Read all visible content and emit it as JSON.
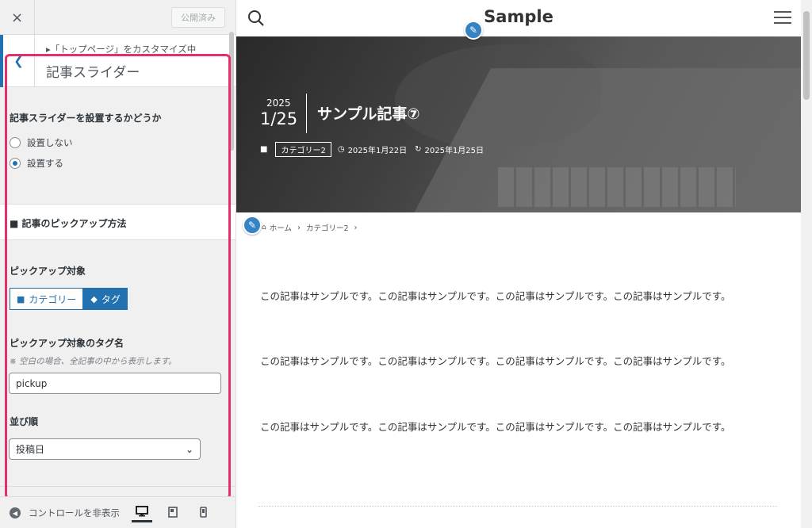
{
  "customizer": {
    "close_icon": "×",
    "publish_label": "公開済み",
    "breadcrumb": "▸「トップページ」をカスタマイズ中",
    "section_title": "記事スライダー",
    "q_show": "記事スライダーを設置するかどうか",
    "radio_no": "設置しない",
    "radio_yes": "設置する",
    "radio_selected": "設置する",
    "pickup_method": "■ 記事のピックアップ方法",
    "pickup_target": "ピックアップ対象",
    "seg_category": "カテゴリー",
    "seg_tag": "タグ",
    "seg_selected": "タグ",
    "tag_name_label": "ピックアップ対象のタグ名",
    "tag_note": "※ 空白の場合、全記事の中から表示します。",
    "tag_value": "pickup",
    "order_label": "並び順",
    "order_value": "投稿日",
    "hide_controls": "コントロールを非表示",
    "highlight_color": "#e3306d",
    "accent_color": "#2271b1"
  },
  "preview": {
    "site_title": "Sample",
    "hero": {
      "year": "2025",
      "month_day": "1/25",
      "title": "サンプル記事⑦",
      "category": "カテゴリー2",
      "published": "2025年1月22日",
      "updated": "2025年1月25日"
    },
    "breadcrumb": {
      "home": "ホーム",
      "category": "カテゴリー2"
    },
    "paragraphs": [
      "この記事はサンプルです。この記事はサンプルです。この記事はサンプルです。この記事はサンプルです。",
      "この記事はサンプルです。この記事はサンプルです。この記事はサンプルです。この記事はサンプルです。",
      "この記事はサンプルです。この記事はサンプルです。この記事はサンプルです。この記事はサンプルです。"
    ]
  },
  "icons": {
    "close": "close-icon",
    "back": "chevron-left-icon",
    "search": "search-icon",
    "menu": "hamburger-menu-icon",
    "edit": "pencil-icon",
    "folder": "folder-icon",
    "tag": "tag-icon",
    "clock": "clock-icon",
    "refresh": "refresh-icon",
    "home": "home-icon",
    "desktop": "desktop-icon",
    "tablet": "tablet-icon",
    "mobile": "mobile-icon",
    "hide": "collapse-icon",
    "dropdown": "chevron-down-icon"
  }
}
